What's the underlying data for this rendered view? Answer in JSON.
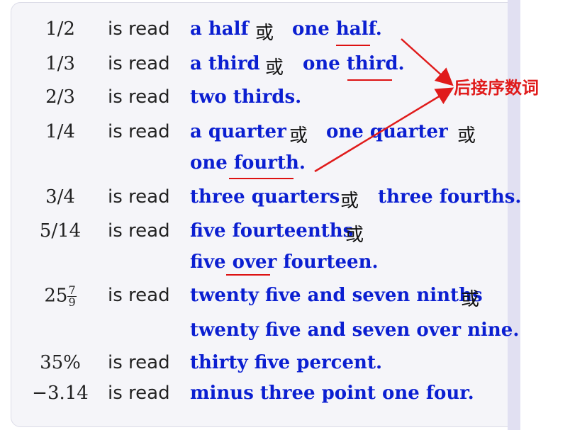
{
  "rows": [
    {
      "left": "1/2",
      "read": "is read",
      "a": "a half",
      "or": "或",
      "b": "one half."
    },
    {
      "left": "1/3",
      "read": "is read",
      "a": "a third",
      "or": "或",
      "b": "one third."
    },
    {
      "left": "2/3",
      "read": "is read",
      "a": "two thirds."
    },
    {
      "left": "1/4",
      "read": "is read",
      "a": "a quarter",
      "or": "或",
      "b": "one quarter",
      "or2": "或",
      "c": "one fourth."
    },
    {
      "left": "3/4",
      "read": "is read",
      "a": "three quarters",
      "or": "或",
      "b": "three fourths."
    },
    {
      "left": "5/14",
      "read": "is read",
      "a": "five fourteenths",
      "or": "或",
      "b": "five over fourteen."
    },
    {
      "left_whole": "25",
      "left_num": "7",
      "left_den": "9",
      "read": "is read",
      "a": "twenty five and seven ninths",
      "or": "或",
      "b": "twenty five and seven over nine."
    },
    {
      "left": "35%",
      "read": "is read",
      "a": "thirty five percent."
    },
    {
      "left": "−3.14",
      "read": "is read",
      "a": "minus three point one four."
    }
  ],
  "annotation": "后接序数词",
  "colors": {
    "phrase": "#0b1fd1",
    "annotation": "#e01b1b",
    "underline": "#dd1111"
  }
}
